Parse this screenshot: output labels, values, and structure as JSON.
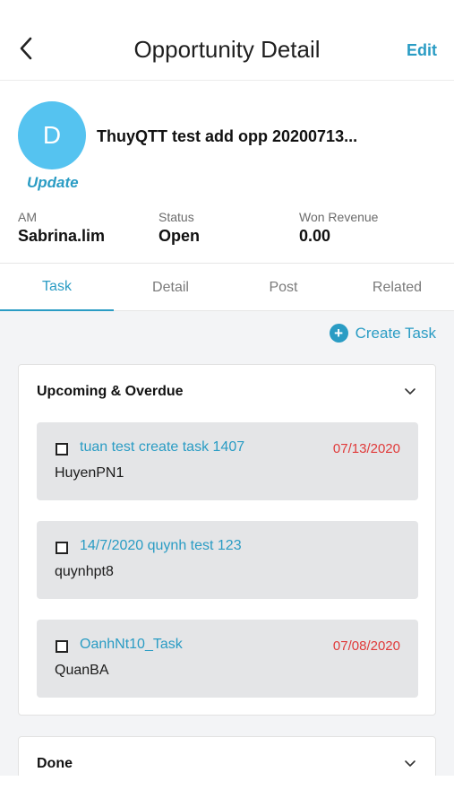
{
  "header": {
    "title": "Opportunity Detail",
    "edit_label": "Edit",
    "back_icon": "chevron-left-icon"
  },
  "profile": {
    "avatar_letter": "D",
    "avatar_color": "#55c3f0",
    "name": "ThuyQTT test add opp 20200713...",
    "update_label": "Update",
    "fields": [
      {
        "label": "AM",
        "value": "Sabrina.lim"
      },
      {
        "label": "Status",
        "value": "Open"
      },
      {
        "label": "Won Revenue",
        "value": "0.00"
      }
    ]
  },
  "tabs": [
    {
      "label": "Task",
      "active": true
    },
    {
      "label": "Detail",
      "active": false
    },
    {
      "label": "Post",
      "active": false
    },
    {
      "label": "Related",
      "active": false
    }
  ],
  "create_task_label": "Create Task",
  "sections": {
    "upcoming": {
      "title": "Upcoming & Overdue",
      "tasks": [
        {
          "title": "tuan test create task 1407",
          "date": "07/13/2020",
          "owner": "HuyenPN1"
        },
        {
          "title": "14/7/2020  quynh test 123",
          "date": "",
          "owner": "quynhpt8"
        },
        {
          "title": "OanhNt10_Task",
          "date": "07/08/2020",
          "owner": "QuanBA"
        }
      ]
    },
    "done": {
      "title": "Done"
    }
  },
  "colors": {
    "accent": "#2a9cc4",
    "overdue": "#e03a3a",
    "task_bg": "#e4e5e7",
    "content_bg": "#f3f4f6"
  }
}
